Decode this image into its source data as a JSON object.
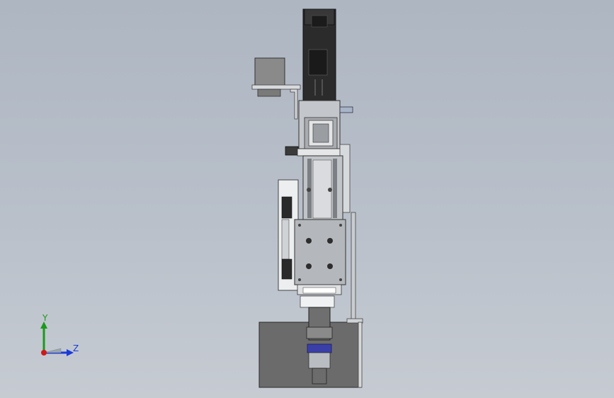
{
  "viewport": {
    "background_top": "#aeb6c2",
    "background_bottom": "#c6cbd2"
  },
  "triad": {
    "y_label": "Y",
    "z_label": "Z",
    "y_color": "#1a9a1a",
    "z_color": "#1a3ad8",
    "x_color": "#d01818"
  },
  "model": {
    "motor_color": "#2a2a2a",
    "metal_color": "#b8bcc2",
    "base_color": "#6e6e6e",
    "accent_ring_color": "#3a3fa8"
  }
}
